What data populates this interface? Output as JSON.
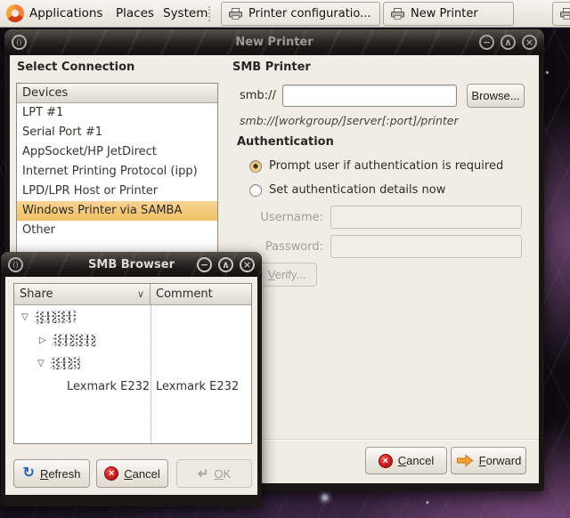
{
  "panel": {
    "menus": {
      "applications": "Applications",
      "places": "Places",
      "system": "System"
    },
    "taskbar": {
      "task1": "Printer configuratio...",
      "task2": "New Printer"
    }
  },
  "new_printer": {
    "title": "New Printer",
    "connection": {
      "heading": "Select Connection",
      "column_header": "Devices",
      "items": [
        "LPT #1",
        "Serial Port #1",
        "AppSocket/HP JetDirect",
        "Internet Printing Protocol (ipp)",
        "LPD/LPR Host or Printer",
        "Windows Printer via SAMBA",
        "Other"
      ],
      "selected_item": "Windows Printer via SAMBA"
    },
    "smb": {
      "heading": "SMB Printer",
      "scheme_label": "smb://",
      "uri_value": "",
      "browse_button": "Browse...",
      "hint": "smb://[workgroup/]server[:port]/printer"
    },
    "authentication": {
      "heading": "Authentication",
      "option_prompt": "Prompt user if authentication is required",
      "option_set_now": "Set authentication details now",
      "selected_option": "Prompt user if authentication is required",
      "username_label": "Username:",
      "username_value": "",
      "password_label": "Password:",
      "password_value": "",
      "verify_button": "Verify..."
    },
    "footer": {
      "cancel_button": "Cancel",
      "forward_button": "Forward"
    }
  },
  "smb_browser": {
    "title": "SMB Browser",
    "columns": {
      "share": "Share",
      "comment": "Comment"
    },
    "tree_rows": [
      {
        "level": 0,
        "expander": "expanded",
        "share": "",
        "comment": "",
        "redacted": true
      },
      {
        "level": 1,
        "expander": "collapsed",
        "share": "",
        "comment": "",
        "redacted": true
      },
      {
        "level": 1,
        "expander": "expanded",
        "share": "",
        "comment": "",
        "redacted": true
      },
      {
        "level": 2,
        "expander": "none",
        "share": "Lexmark E232",
        "comment": "Lexmark E232",
        "redacted": false
      }
    ],
    "buttons": {
      "refresh": "Refresh",
      "cancel": "Cancel",
      "ok": "OK"
    }
  },
  "icons": {
    "window_menu": "()",
    "minimize": "−",
    "maximize": "∧",
    "close": "×",
    "cancel_x": "×",
    "refresh": "↻",
    "ok_enter": "↵",
    "sort_descending": "∨",
    "expander_open": "▽",
    "expander_closed": "▷"
  },
  "colors": {
    "selection_orange": "#f2c36b",
    "radio_accent": "#f6c87e",
    "cancel_red": "#ce1d1d",
    "forward_orange": "#f9a23a",
    "refresh_blue": "#2d5fb8",
    "titlebar_dark": "#2c2925",
    "window_bg": "#f1ece5",
    "panel_bg": "#ece7e0"
  }
}
